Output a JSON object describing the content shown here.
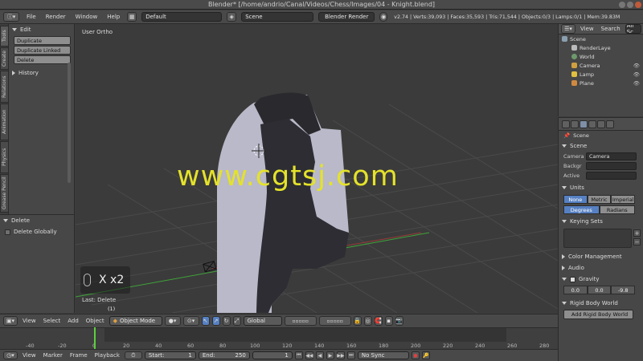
{
  "window": {
    "title": "Blender* [/home/andrio/Canal/Videos/Chess/Images/04 - Knight.blend]"
  },
  "infobar": {
    "menus": [
      "File",
      "Render",
      "Window",
      "Help"
    ],
    "layout": "Default",
    "scene": "Scene",
    "engine": "Blender Render",
    "stats": "v2.74 | Verts:39,093 | Faces:35,593 | Tris:71,544 | Objects:0/3 | Lamps:0/1 | Mem:39.83M"
  },
  "left_tabs": [
    "Tools",
    "Create",
    "Relations",
    "Animation",
    "Physics",
    "Grease Pencil"
  ],
  "toolshelf": {
    "edit_header": "Edit",
    "buttons": [
      "Duplicate",
      "Duplicate Linked",
      "Delete"
    ],
    "history_header": "History"
  },
  "operator_panel": {
    "header": "Delete",
    "option": "Delete Globally"
  },
  "viewport": {
    "label": "User Ortho",
    "watermark": "www.cgtsj.com",
    "key_hint": "X x2",
    "last_op": "Last: Delete",
    "obj_count": "(1)"
  },
  "outliner": {
    "menus": [
      "View",
      "Search",
      "All Sc"
    ],
    "items": [
      "Scene",
      "RenderLaye",
      "World",
      "Camera",
      "Lamp",
      "Plane"
    ]
  },
  "properties": {
    "scene_label": "Scene",
    "panel_scene": "Scene",
    "camera_label": "Camera",
    "camera_value": "Camera",
    "backgr_label": "Backgr",
    "active_label": "Active",
    "units_header": "Units",
    "units": [
      "None",
      "Metric",
      "Imperial"
    ],
    "rotation": [
      "Degrees",
      "Radians"
    ],
    "keying_header": "Keying Sets",
    "color_mgmt": "Color Management",
    "audio": "Audio",
    "gravity": "Gravity",
    "gravity_values": [
      "0.0",
      "0.0",
      "-9.8"
    ],
    "rigid_header": "Rigid Body World",
    "rigid_btn": "Add Rigid Body World"
  },
  "view3d_header": {
    "menus": [
      "View",
      "Select",
      "Add",
      "Object"
    ],
    "mode": "Object Mode",
    "orientation": "Global"
  },
  "timeline": {
    "ticks": [
      "-40",
      "-20",
      "0",
      "20",
      "40",
      "60",
      "80",
      "100",
      "120",
      "140",
      "160",
      "180",
      "200",
      "220",
      "240",
      "260",
      "280"
    ],
    "menus": [
      "View",
      "Marker",
      "Frame",
      "Playback"
    ],
    "start_label": "Start:",
    "start": "1",
    "end_label": "End:",
    "end": "250",
    "current": "1",
    "sync": "No Sync"
  }
}
